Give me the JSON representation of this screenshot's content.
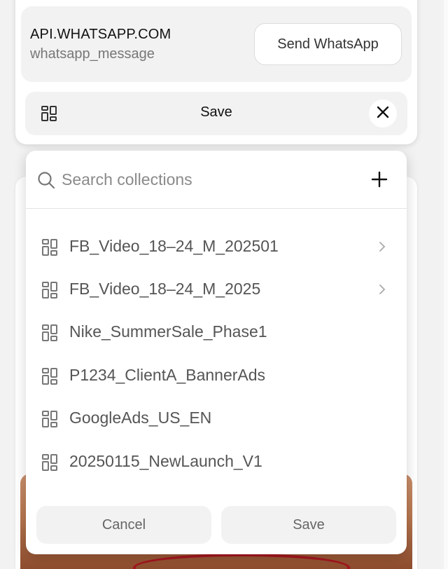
{
  "link_preview": {
    "domain": "API.WHATSAPP.COM",
    "subtitle": "whatsapp_message",
    "action_label": "Send WhatsApp"
  },
  "save_bar": {
    "icon": "collection-grid-icon",
    "label": "Save",
    "close_icon": "close-icon"
  },
  "collections_popover": {
    "search": {
      "placeholder": "Search collections",
      "value": "",
      "icon": "search-icon"
    },
    "add_icon": "plus-icon",
    "items": [
      {
        "label": "FB_Video_18–24_M_202501",
        "has_children": true
      },
      {
        "label": "FB_Video_18–24_M_2025",
        "has_children": true
      },
      {
        "label": "Nike_SummerSale_Phase1",
        "has_children": false
      },
      {
        "label": "P1234_ClientA_BannerAds",
        "has_children": false
      },
      {
        "label": "GoogleAds_US_EN",
        "has_children": false
      },
      {
        "label": "20250115_NewLaunch_V1",
        "has_children": false
      }
    ],
    "cancel_label": "Cancel",
    "save_label": "Save"
  }
}
